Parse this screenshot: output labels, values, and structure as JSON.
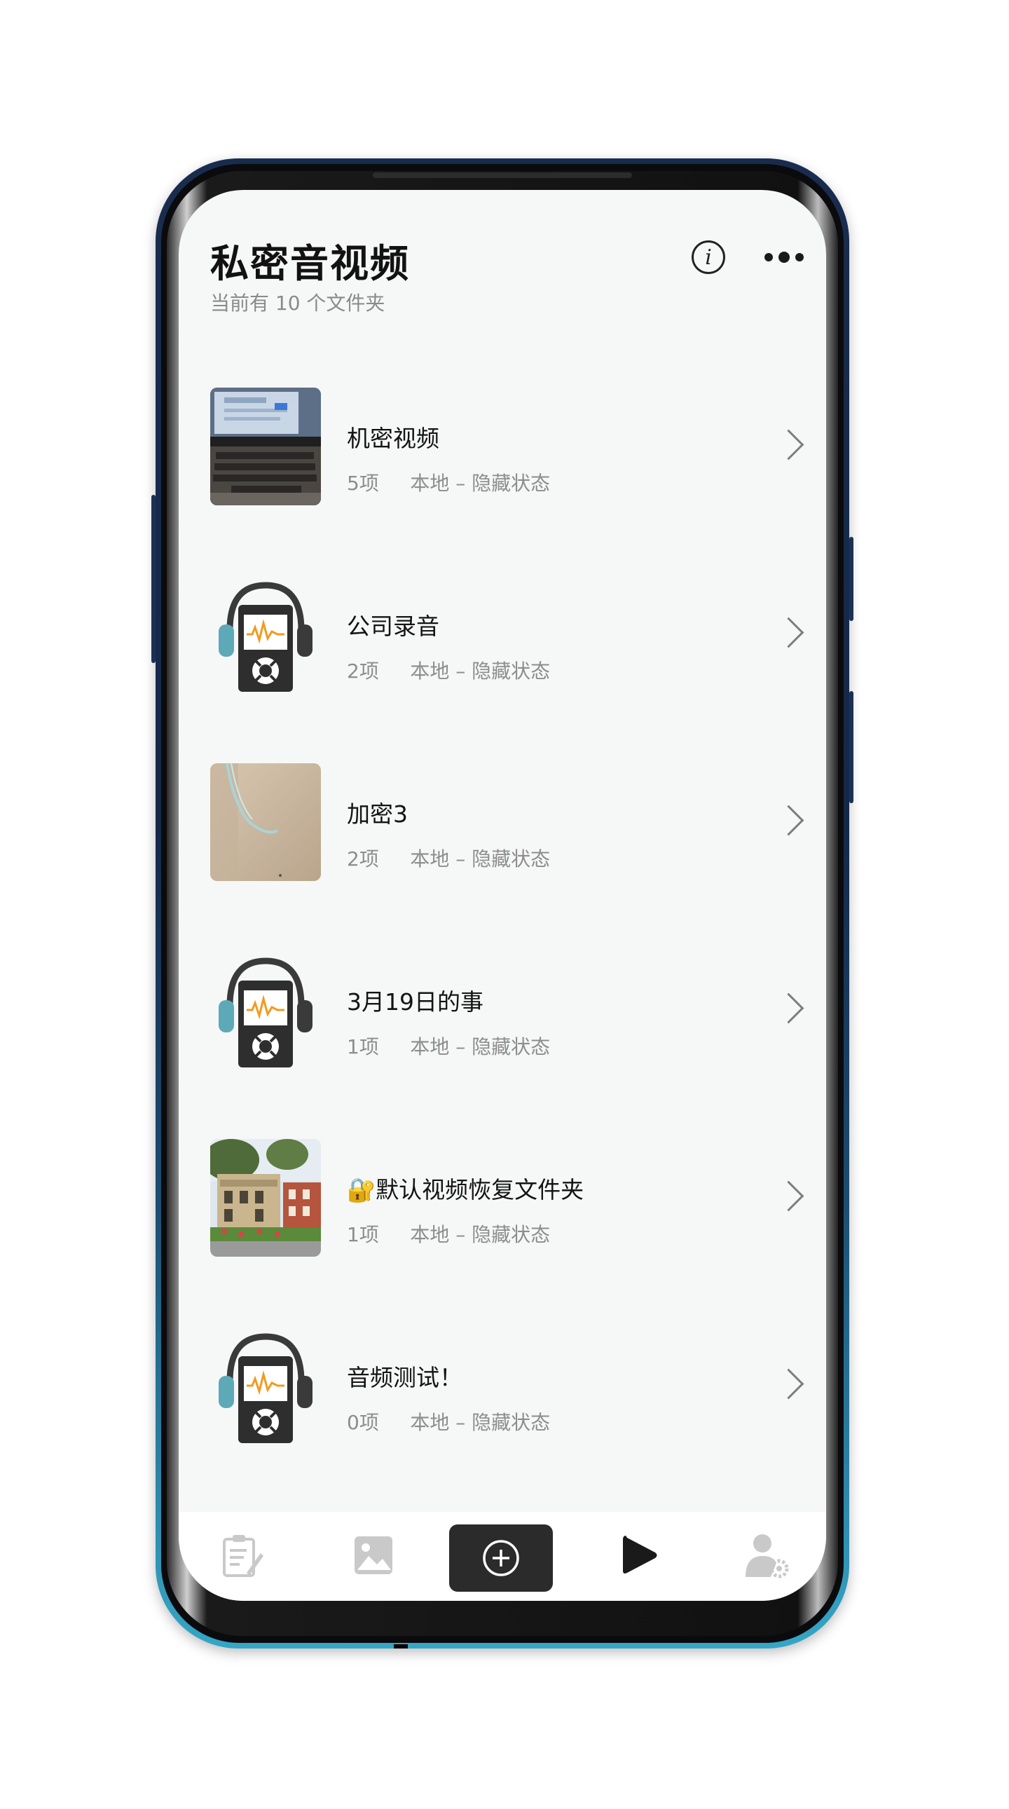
{
  "header": {
    "title": "私密音视频",
    "subtitle": "当前有 10 个文件夹"
  },
  "icons": {
    "info": "info-icon",
    "more": "more-horizontal-icon",
    "row_chevron": "chevron-right-icon",
    "audio_thumbnail": "audio-player-headphones-icon",
    "lock": "lock-emoji-icon"
  },
  "folders": [
    {
      "name": "机密视频",
      "count": "5项",
      "location": "本地 – 隐藏状态",
      "thumb": "video-thumbnail-laptop"
    },
    {
      "name": "公司录音",
      "count": "2项",
      "location": "本地 – 隐藏状态",
      "thumb": "audio-player-headphones-icon"
    },
    {
      "name": "加密3",
      "count": "2项",
      "location": "本地 – 隐藏状态",
      "thumb": "video-thumbnail-wood-cable"
    },
    {
      "name": "3月19日的事",
      "count": "1项",
      "location": "本地 – 隐藏状态",
      "thumb": "audio-player-headphones-icon"
    },
    {
      "name": "默认视频恢复文件夹",
      "lock_prefix": "🔐",
      "count": "1项",
      "location": "本地 – 隐藏状态",
      "thumb": "video-thumbnail-buildings"
    },
    {
      "name": "音频测试！",
      "count": "0项",
      "location": "本地 – 隐藏状态",
      "thumb": "audio-player-headphones-icon"
    }
  ],
  "bottom_nav": [
    {
      "name": "notes-tab",
      "icon": "notes-edit-icon"
    },
    {
      "name": "photos-tab",
      "icon": "image-icon"
    },
    {
      "name": "add-tab",
      "icon": "plus-circle-icon"
    },
    {
      "name": "media-tab",
      "icon": "play-icon"
    },
    {
      "name": "user-settings-tab",
      "icon": "user-gear-icon"
    }
  ],
  "colors": {
    "screen_bg": "#f6f7f7",
    "title_text": "#121212",
    "meta_text": "#8d8d8d",
    "nav_add_bg": "#2b2b2b",
    "audio_accent_orange": "#f29a1f",
    "audio_accent_teal": "#5ea9b8"
  }
}
